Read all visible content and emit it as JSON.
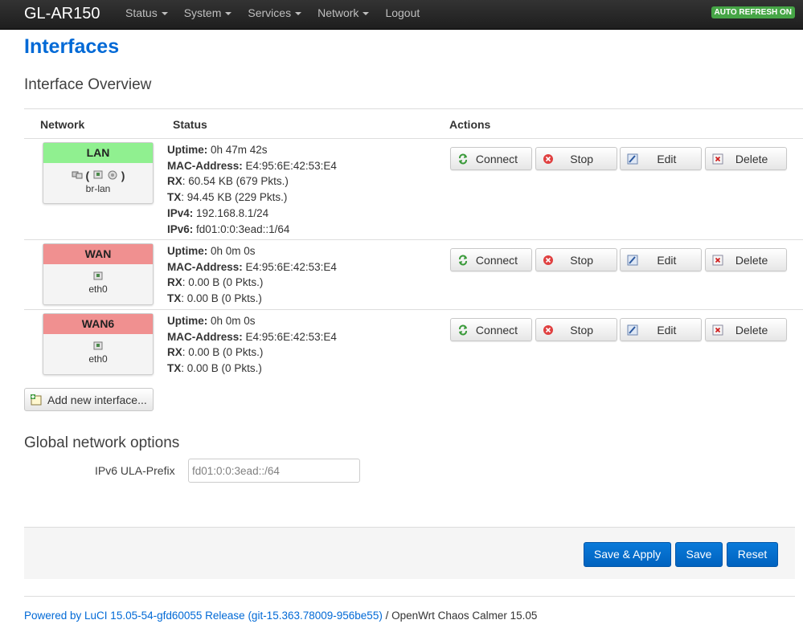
{
  "header": {
    "brand": "GL-AR150",
    "nav": [
      "Status",
      "System",
      "Services",
      "Network",
      "Logout"
    ],
    "auto_refresh": "AUTO REFRESH ON"
  },
  "page_title": "Interfaces",
  "overview": {
    "title": "Interface Overview",
    "columns": {
      "network": "Network",
      "status": "Status",
      "actions": "Actions"
    },
    "action_labels": {
      "connect": "Connect",
      "stop": "Stop",
      "edit": "Edit",
      "delete": "Delete"
    },
    "interfaces": [
      {
        "name": "LAN",
        "head_color": "#90f090",
        "device": "br-lan",
        "uptime": "0h 47m 42s",
        "mac": "E4:95:6E:42:53:E4",
        "rx": "60.54 KB (679 Pkts.)",
        "tx": "94.45 KB (229 Pkts.)",
        "ipv4": "192.168.8.1/24",
        "ipv6": "fd01:0:0:3ead::1/64"
      },
      {
        "name": "WAN",
        "head_color": "#f09090",
        "device": "eth0",
        "uptime": "0h 0m 0s",
        "mac": "E4:95:6E:42:53:E4",
        "rx": "0.00 B (0 Pkts.)",
        "tx": "0.00 B (0 Pkts.)"
      },
      {
        "name": "WAN6",
        "head_color": "#f09090",
        "device": "eth0",
        "uptime": "0h 0m 0s",
        "mac": "E4:95:6E:42:53:E4",
        "rx": "0.00 B (0 Pkts.)",
        "tx": "0.00 B (0 Pkts.)"
      }
    ],
    "add_label": "Add new interface..."
  },
  "global": {
    "title": "Global network options",
    "ula_label": "IPv6 ULA-Prefix",
    "ula_value": "fd01:0:0:3ead::/64"
  },
  "buttons": {
    "save_apply": "Save & Apply",
    "save": "Save",
    "reset": "Reset"
  },
  "footer": {
    "link_text": "Powered by LuCI 15.05-54-gfd60055 Release (git-15.363.78009-956be55)",
    "rest": " / OpenWrt Chaos Calmer 15.05"
  },
  "field_labels": {
    "uptime": "Uptime:",
    "mac": "MAC-Address:",
    "rx": "RX",
    "tx": "TX",
    "ipv4": "IPv4:",
    "ipv6": "IPv6:"
  },
  "icons": {
    "connect": "refresh-icon",
    "stop": "stop-icon",
    "edit": "edit-icon",
    "delete": "delete-icon",
    "add": "add-interface-icon",
    "network": "network-device-icon"
  },
  "colors": {
    "accent": "#0069d6",
    "primary_button": "#0069d6",
    "refresh_badge": "#46a546"
  }
}
